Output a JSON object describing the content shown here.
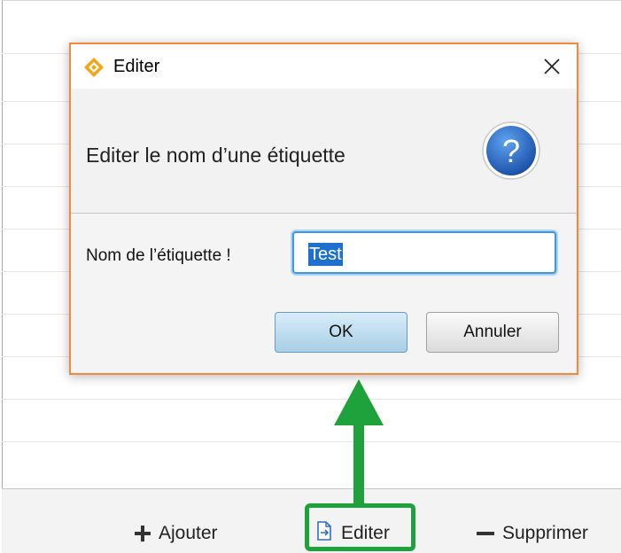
{
  "dialog": {
    "title": "Editer",
    "header_text": "Editer le nom d’une étiquette",
    "field_label": "Nom de l’étiquette !",
    "input_value": "Test",
    "ok_label": "OK",
    "cancel_label": "Annuler"
  },
  "toolbar": {
    "add_label": "Ajouter",
    "edit_label": "Editer",
    "delete_label": "Supprimer"
  },
  "colors": {
    "dialog_border": "#f08a3c",
    "highlight": "#1fa13b",
    "input_focus": "#3b9ae0",
    "selection": "#1d6fd0"
  }
}
